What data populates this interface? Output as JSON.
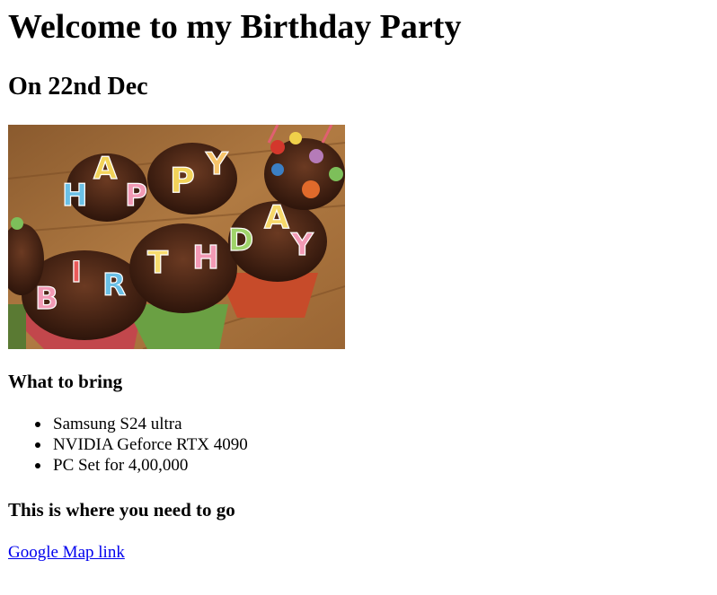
{
  "page": {
    "title": "Welcome to my Birthday Party",
    "date_heading": "On 22nd Dec",
    "image": {
      "name": "birthday-cupcakes-image",
      "letters": [
        "H",
        "A",
        "P",
        "P",
        "Y",
        "B",
        "I",
        "R",
        "T",
        "H",
        "D",
        "A",
        "Y"
      ]
    },
    "bring_heading": "What to bring",
    "bring_items": [
      "Samsung S24 ultra",
      "NVIDIA Geforce RTX 4090",
      "PC Set for 4,00,000"
    ],
    "where_heading": "This is where you need to go",
    "map_link_text": "Google Map link"
  },
  "colors": {
    "link": "#0000ee",
    "text": "#000000",
    "background": "#ffffff"
  }
}
